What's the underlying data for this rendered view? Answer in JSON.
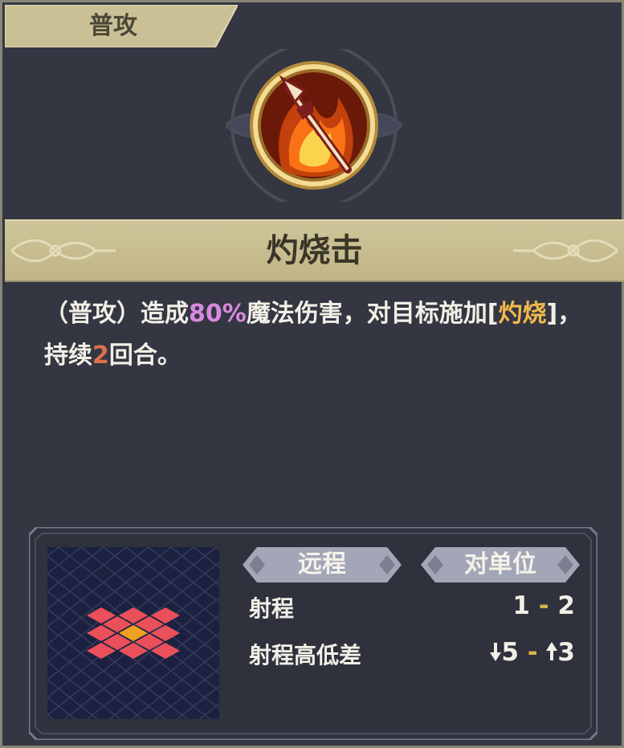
{
  "tab": {
    "label": "普攻"
  },
  "skill": {
    "name": "灼烧击",
    "icon": "flame-spear-icon"
  },
  "description": {
    "prefix": "（普攻）造成",
    "damage_pct": "80%",
    "mid": "魔法伤害，对目标施加[",
    "status": "灼烧",
    "mid2": "]，持续",
    "duration": "2",
    "suffix": "回合。"
  },
  "attack": {
    "type_label": "远程",
    "target_label": "对单位",
    "range_label": "射程",
    "range_min": "1",
    "range_max": "2",
    "height_label": "射程高低差",
    "height_down": "5",
    "height_up": "3"
  },
  "colors": {
    "accent_gold": "#cec59a",
    "damage_purple": "#d98ae0",
    "status_gold": "#f0b94a",
    "duration_red": "#e0704a",
    "range_tile": "#e9505a",
    "center_tile": "#f0a020"
  }
}
